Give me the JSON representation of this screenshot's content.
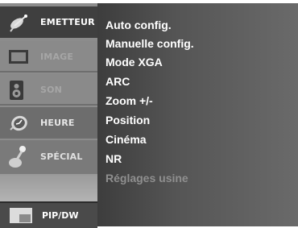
{
  "sidebar": {
    "items": [
      {
        "label": "EMETTEUR",
        "icon": "satellite-dish-icon",
        "state": "active"
      },
      {
        "label": "IMAGE",
        "icon": "monitor-icon",
        "state": "dim"
      },
      {
        "label": "SON",
        "icon": "speaker-icon",
        "state": "dim"
      },
      {
        "label": "HEURE",
        "icon": "clock-icon",
        "state": "normal"
      },
      {
        "label": "SPÉCIAL",
        "icon": "joystick-icon",
        "state": "normal"
      }
    ],
    "pip": {
      "label": "PIP/DW",
      "icon": "pip-icon"
    }
  },
  "menu": {
    "options": [
      {
        "label": "Auto config.",
        "state": "enabled"
      },
      {
        "label": "Manuelle config.",
        "state": "enabled"
      },
      {
        "label": "Mode XGA",
        "state": "enabled"
      },
      {
        "label": "ARC",
        "state": "enabled"
      },
      {
        "label": "Zoom +/-",
        "state": "enabled"
      },
      {
        "label": "Position",
        "state": "enabled"
      },
      {
        "label": "Cinéma",
        "state": "enabled"
      },
      {
        "label": "NR",
        "state": "enabled"
      },
      {
        "label": "Réglages usine",
        "state": "disabled"
      }
    ]
  }
}
